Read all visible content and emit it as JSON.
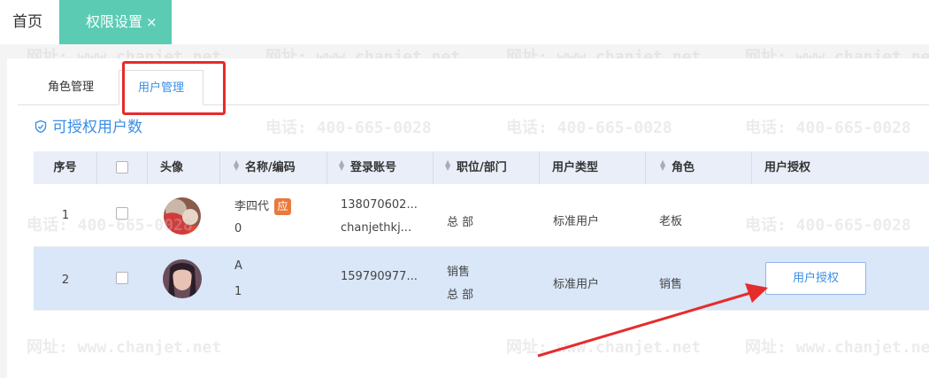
{
  "tabs": {
    "home_label": "首页",
    "active_label": "权限设置",
    "close_glyph": "×"
  },
  "subtabs": {
    "role_label": "角色管理",
    "user_label": "用户管理"
  },
  "authorizable_users_label": "可授权用户数",
  "table": {
    "headers": {
      "index": "序号",
      "avatar": "头像",
      "name": "名称/编码",
      "login": "登录账号",
      "position": "职位/部门",
      "user_type": "用户类型",
      "role": "角色",
      "auth": "用户授权"
    },
    "rows": [
      {
        "index": "1",
        "name": "李四代",
        "badge": "应",
        "code": "0",
        "login_line1": "138070602...",
        "login_line2": "chanjethkj...",
        "position": "",
        "department": "总 部",
        "user_type": "标准用户",
        "role": "老板",
        "auth_button": ""
      },
      {
        "index": "2",
        "name": "A",
        "badge": "",
        "code": "1",
        "login_line1": "159790977...",
        "login_line2": "",
        "position": "销售",
        "department": "总 部",
        "user_type": "标准用户",
        "role": "销售",
        "auth_button": "用户授权"
      }
    ]
  },
  "watermarks": {
    "phone": "电话: 400-665-0028",
    "site": "网址: www.chanjet.net"
  },
  "colors": {
    "accent_tab": "#5bcbb4",
    "link_blue": "#3a8ee6",
    "highlight_red": "#e52c2c",
    "selected_row": "#d9e7f8",
    "badge_orange": "#e9793d"
  },
  "icons": {
    "count_icon": "shield-check-icon",
    "sort_icon": "sort-updown-icon"
  }
}
